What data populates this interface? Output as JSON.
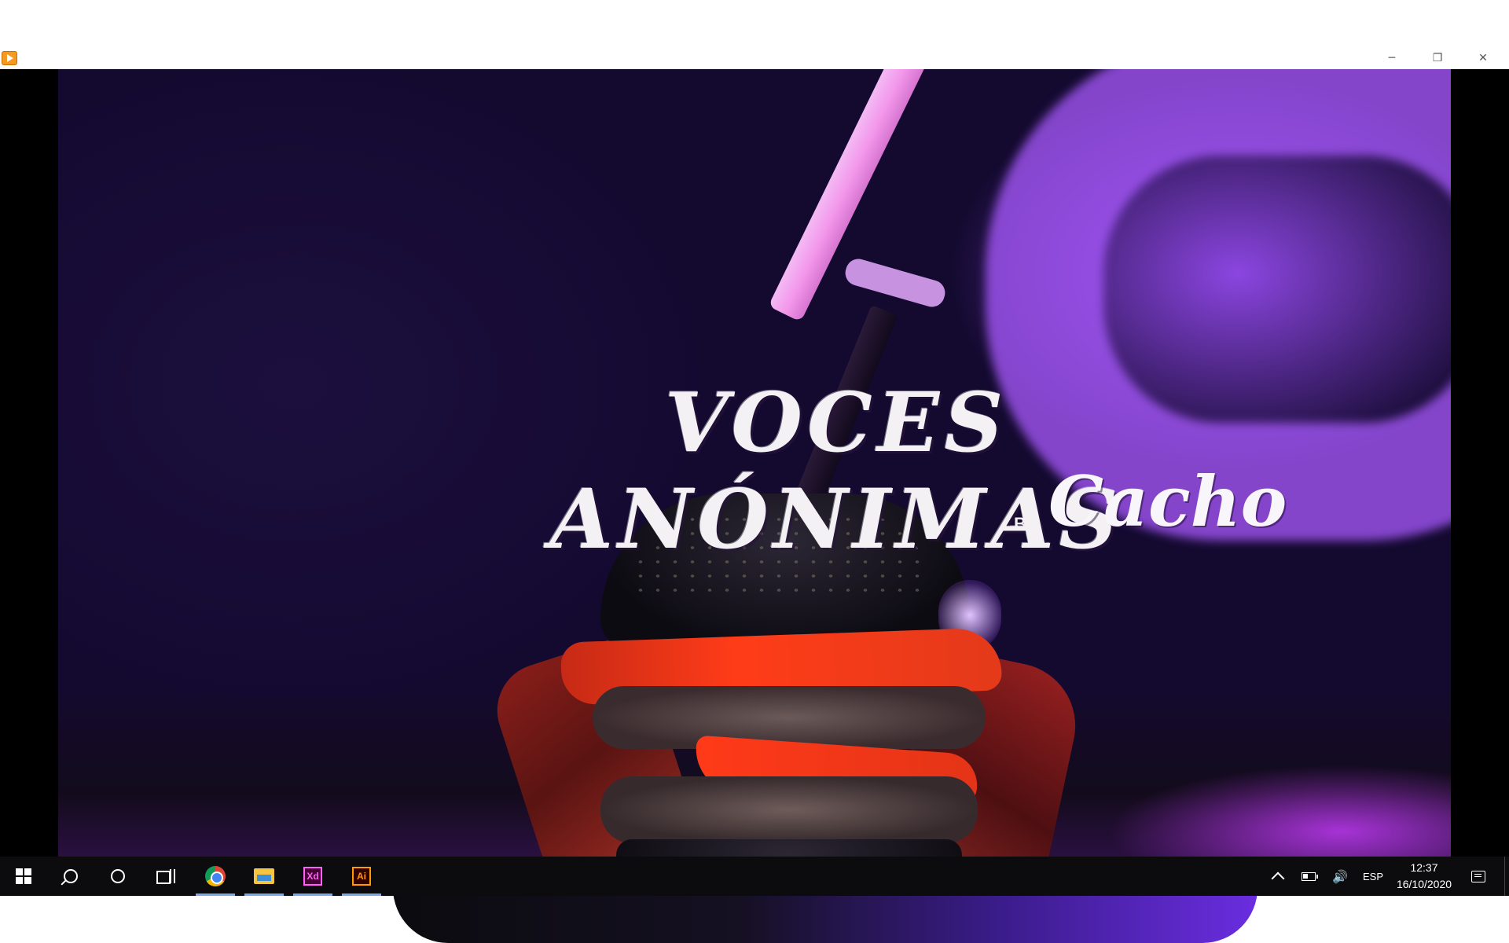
{
  "window": {
    "app_icon": "media-player-icon",
    "controls": {
      "minimize": "─",
      "maximize": "❐",
      "close": "✕"
    }
  },
  "video": {
    "title": "VOCES ANÓNIMAS",
    "by": "BY",
    "brand": "Cacho"
  },
  "taskbar": {
    "apps": [
      {
        "name": "start",
        "icon": "windows-logo-icon"
      },
      {
        "name": "search",
        "icon": "search-icon"
      },
      {
        "name": "cortana",
        "icon": "cortana-circle-icon"
      },
      {
        "name": "task-view",
        "icon": "task-view-icon"
      },
      {
        "name": "chrome",
        "icon": "chrome-icon",
        "active": true
      },
      {
        "name": "file-explorer",
        "icon": "folder-icon",
        "active": true
      },
      {
        "name": "adobe-xd",
        "icon": "xd-icon",
        "label": "Xd",
        "active": true
      },
      {
        "name": "adobe-illustrator",
        "icon": "ai-icon",
        "label": "Ai",
        "active": true
      }
    ],
    "tray": {
      "chevron": "chevron-up-icon",
      "battery": "battery-icon",
      "volume_glyph": "🔊",
      "language": "ESP",
      "time": "12:37",
      "date": "16/10/2020",
      "notifications": "notification-icon"
    }
  },
  "colors": {
    "taskbar_bg": "#0c0c0f",
    "active_indicator": "#7aa9e8",
    "video_purple": "#2a1466",
    "ring_violet": "#aa5aff"
  }
}
